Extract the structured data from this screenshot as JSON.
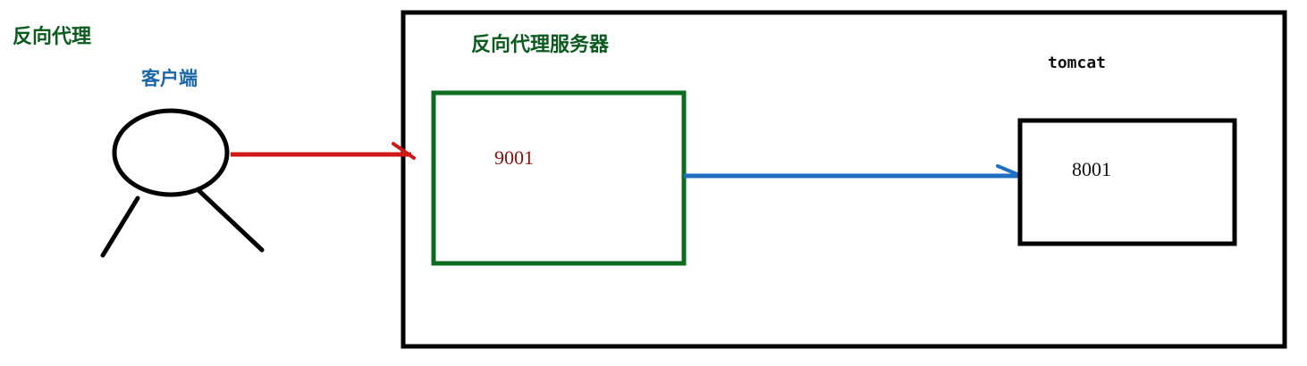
{
  "diagram": {
    "title": "反向代理",
    "client": {
      "label": "客户端"
    },
    "proxy_server": {
      "label": "反向代理服务器",
      "port": "9001"
    },
    "tomcat": {
      "label": "tomcat",
      "port": "8001"
    },
    "colors": {
      "title": "#0b5a1e",
      "client_label": "#1a66a8",
      "proxy_box": "#0b6b1f",
      "proxy_port": "#8b0f0f",
      "request_arrow": "#d01818",
      "forward_arrow": "#1f6fc0",
      "outline": "#000000"
    }
  }
}
